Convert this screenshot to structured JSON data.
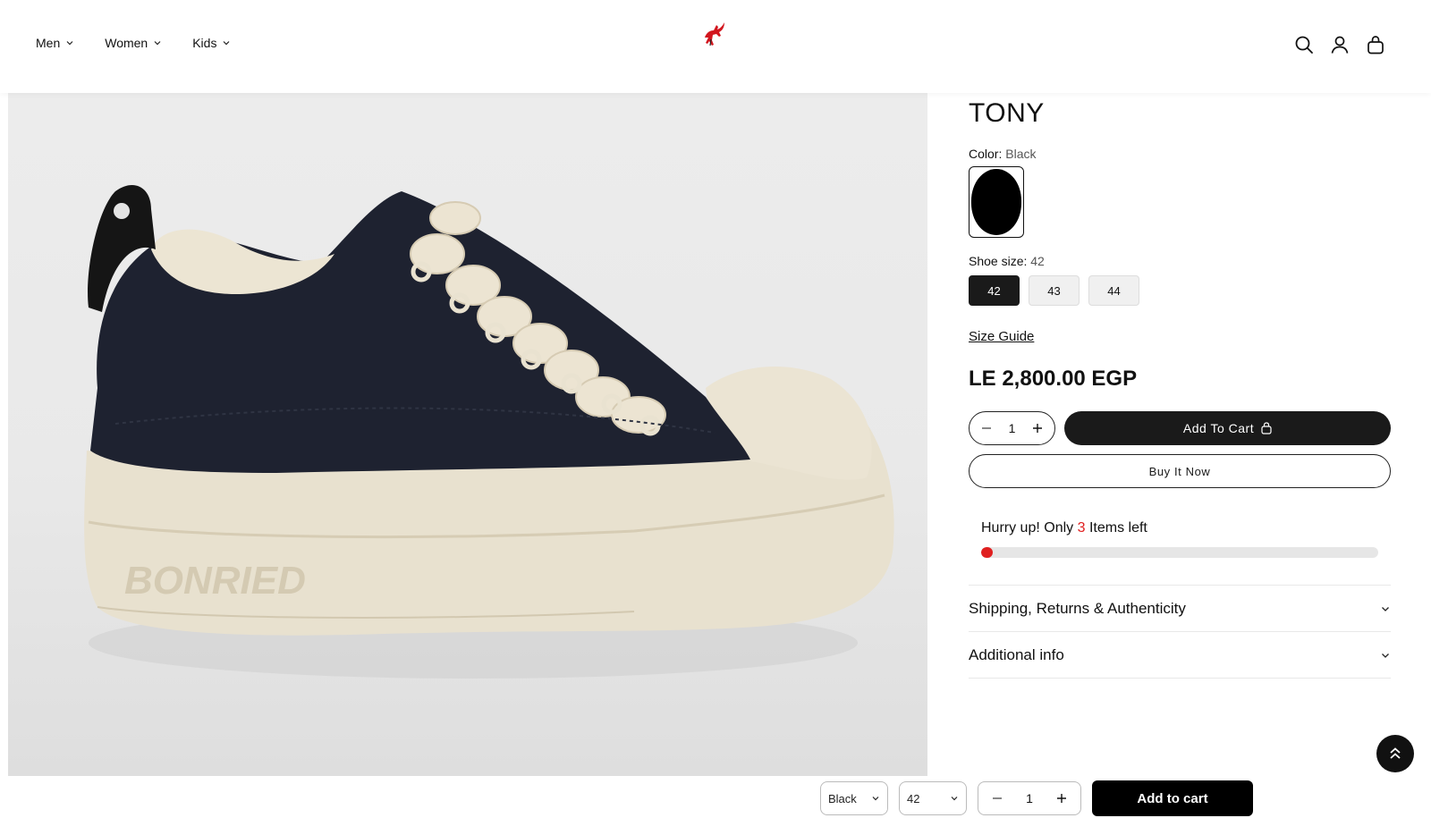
{
  "nav": {
    "items": [
      {
        "label": "Men"
      },
      {
        "label": "Women"
      },
      {
        "label": "Kids"
      }
    ]
  },
  "header_icons": [
    "search-icon",
    "account-icon",
    "bag-icon"
  ],
  "product": {
    "title": "TONY",
    "image_text": "BONRIED",
    "color_label": "Color:",
    "color_value": "Black",
    "size_label": "Shoe size:",
    "size_value": "42",
    "sizes": [
      "42",
      "43",
      "44"
    ],
    "selected_size": "42",
    "size_guide": "Size Guide",
    "price": "LE 2,800.00 EGP",
    "quantity": "1",
    "add_to_cart": "Add To Cart",
    "buy_now": "Buy It Now"
  },
  "stock": {
    "prefix": "Hurry up! Only",
    "count": "3",
    "suffix": "Items left",
    "fill_fraction": 0.03
  },
  "accordion": [
    {
      "label": "Shipping, Returns & Authenticity"
    },
    {
      "label": "Additional info"
    }
  ],
  "sticky_bar": {
    "color": "Black",
    "size": "42",
    "quantity": "1",
    "add_to_cart": "Add to cart"
  },
  "colors": {
    "accent": "#1a1a1a",
    "stock_red": "#e02020",
    "logo_red": "#d2161e"
  }
}
